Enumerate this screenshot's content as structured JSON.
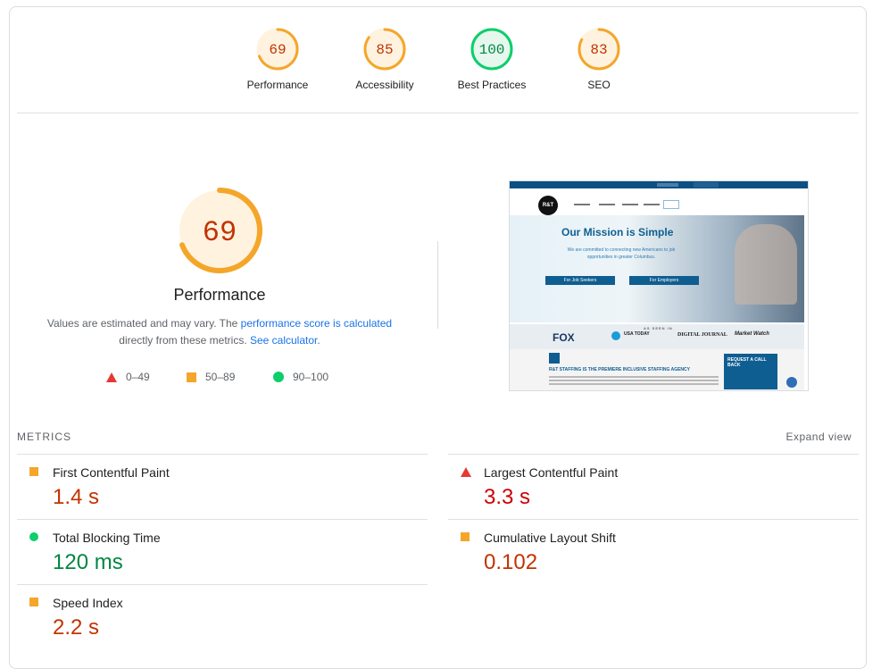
{
  "gauges": [
    {
      "value": "69",
      "label": "Performance",
      "score": 69,
      "color": "#f4a62a",
      "text_color": "#c33300",
      "bg": "#fff3e0"
    },
    {
      "value": "85",
      "label": "Accessibility",
      "score": 85,
      "color": "#f4a62a",
      "text_color": "#c33300",
      "bg": "#fff3e0"
    },
    {
      "value": "100",
      "label": "Best Practices",
      "score": 100,
      "color": "#0cce6b",
      "text_color": "#018642",
      "bg": "#e6f7ed"
    },
    {
      "value": "83",
      "label": "SEO",
      "score": 83,
      "color": "#f4a62a",
      "text_color": "#c33300",
      "bg": "#fff3e0"
    }
  ],
  "main": {
    "score": "69",
    "score_value": 69,
    "title": "Performance",
    "desc_1": "Values are estimated and may vary. The ",
    "desc_link": "performance score is calculated",
    "desc_2": "directly from these metrics. ",
    "calc_link": "See calculator",
    "calc_end": "."
  },
  "legend": [
    {
      "range": "0–49",
      "shape": "triangle",
      "color": "#e53935"
    },
    {
      "range": "50–89",
      "shape": "square",
      "color": "#f4a62a"
    },
    {
      "range": "90–100",
      "shape": "circle",
      "color": "#0cce6b"
    }
  ],
  "screenshot": {
    "hero_title": "Our Mission is Simple",
    "hero_text": "We are committed to connecting new Americans to job opportunities in greater Columbus.",
    "btn_seekers": "For Job Seekers",
    "btn_employers": "For Employers",
    "as_seen": "AS SEEN IN",
    "fox": "FOX",
    "usa_today": "USA TODAY",
    "digital_journal": "DIGITAL JOURNAL",
    "market_watch": "Market Watch",
    "agency_heading": "R&T STAFFING IS THE PREMIERE INCLUSIVE STAFFING AGENCY",
    "cta": "REQUEST A CALL BACK",
    "logo": "R&T"
  },
  "metrics": {
    "heading": "METRICS",
    "expand": "Expand view",
    "items": [
      {
        "name": "First Contentful Paint",
        "value": "1.4 s",
        "status": "average"
      },
      {
        "name": "Largest Contentful Paint",
        "value": "3.3 s",
        "status": "fail"
      },
      {
        "name": "Total Blocking Time",
        "value": "120 ms",
        "status": "pass"
      },
      {
        "name": "Cumulative Layout Shift",
        "value": "0.102",
        "status": "average"
      },
      {
        "name": "Speed Index",
        "value": "2.2 s",
        "status": "average"
      }
    ]
  }
}
